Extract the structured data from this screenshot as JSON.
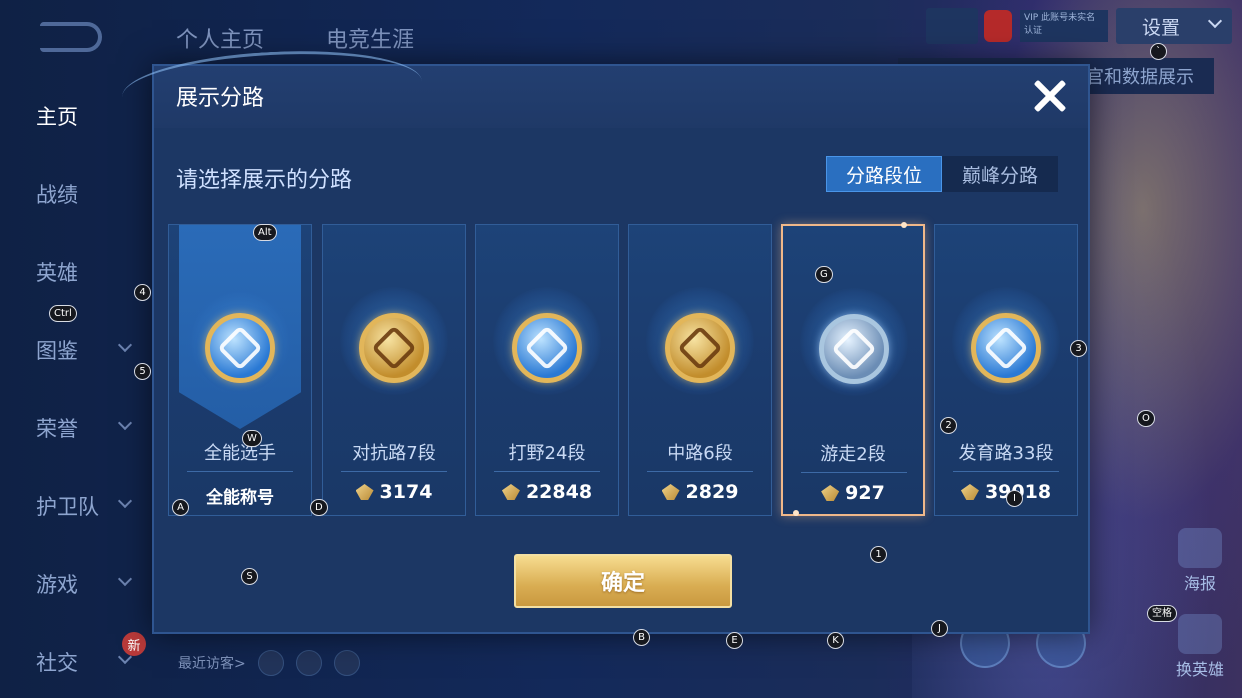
{
  "background": {
    "top_nav": [
      "个人主页",
      "电竞生涯"
    ],
    "sidebar": [
      {
        "label": "主页",
        "active": true,
        "chevron": false
      },
      {
        "label": "战绩",
        "active": false,
        "chevron": false
      },
      {
        "label": "英雄",
        "active": false,
        "chevron": false
      },
      {
        "label": "图鉴",
        "active": false,
        "chevron": true
      },
      {
        "label": "荣誉",
        "active": false,
        "chevron": true
      },
      {
        "label": "护卫队",
        "active": false,
        "chevron": true
      },
      {
        "label": "游戏",
        "active": false,
        "chevron": true
      },
      {
        "label": "社交",
        "active": false,
        "chevron": true,
        "badge": "新"
      }
    ],
    "settings_label": "设置",
    "vip_label": "VIP",
    "vip_text": "此账号未实名认证",
    "data_display_label": "官和数据展示",
    "visitors_label": "最近访客>",
    "right_actions": [
      "海报",
      "换英雄"
    ]
  },
  "modal": {
    "title": "展示分路",
    "subtitle": "请选择展示的分路",
    "tabs": [
      {
        "label": "分路段位",
        "active": true
      },
      {
        "label": "巅峰分路",
        "active": false
      }
    ],
    "cards": [
      {
        "name": "全能选手",
        "value": "全能称号",
        "value_type": "title",
        "medal": "blue",
        "banner": true,
        "selected": false
      },
      {
        "name": "对抗路7段",
        "value": "3174",
        "value_type": "points",
        "medal": "gold",
        "banner": false,
        "selected": false
      },
      {
        "name": "打野24段",
        "value": "22848",
        "value_type": "points",
        "medal": "blue",
        "banner": false,
        "selected": false
      },
      {
        "name": "中路6段",
        "value": "2829",
        "value_type": "points",
        "medal": "gold",
        "banner": false,
        "selected": false
      },
      {
        "name": "游走2段",
        "value": "927",
        "value_type": "points",
        "medal": "silver",
        "banner": false,
        "selected": true
      },
      {
        "name": "发育路33段",
        "value": "39018",
        "value_type": "points",
        "medal": "blue",
        "banner": false,
        "selected": false
      }
    ],
    "confirm_label": "确定"
  },
  "key_hints": [
    "`",
    "Alt",
    "4",
    "Ctrl",
    "5",
    "G",
    "3",
    "W",
    "2",
    "O",
    "A",
    "D",
    "I",
    "1",
    "S",
    "空格",
    "J",
    "B",
    "E",
    "K"
  ],
  "colors": {
    "accent_blue": "#2a6fc0",
    "confirm_gold": "#d9ad52",
    "selected_border": "#f0b88a"
  }
}
